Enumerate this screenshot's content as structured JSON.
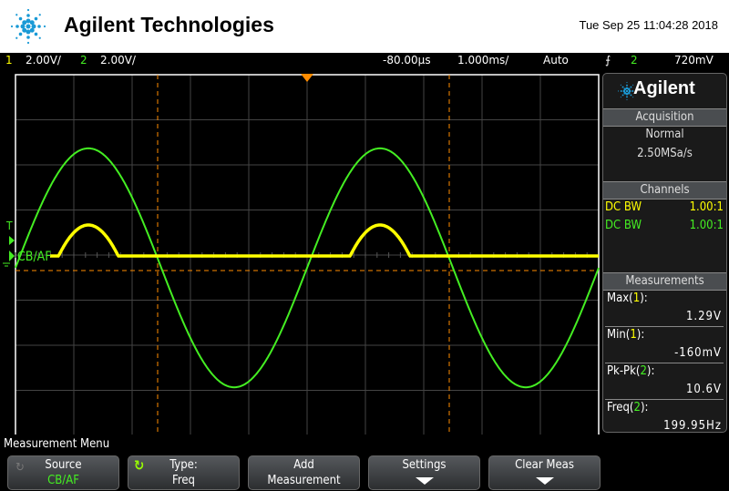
{
  "header": {
    "brand": "Agilent Technologies",
    "datetime": "Tue Sep 25 11:04:28 2018"
  },
  "status": {
    "ch1_num": "1",
    "ch1_scale": "2.00V/",
    "ch2_num": "2",
    "ch2_scale": "2.00V/",
    "time_offset": "-80.00µs",
    "time_scale": "1.000ms/",
    "trigger_mode": "Auto",
    "trigger_edge_icon": "rising-edge-icon",
    "trigger_source": "2",
    "trigger_level": "720mV"
  },
  "markers": {
    "trigger": "T",
    "ch2_label": "CB/AF"
  },
  "waveforms": {
    "ch2_frequency_hz": 199.95,
    "ch2_pk_pk_v": 10.6,
    "ch1_max_v": 1.29,
    "ch1_min_v": -0.16,
    "ch1_color": "#ffff00",
    "ch2_color": "#44ee22",
    "cursor_color": "#ff8c00"
  },
  "panel": {
    "title": "Agilent",
    "acquisition": {
      "title": "Acquisition",
      "mode": "Normal",
      "rate": "2.50MSa/s"
    },
    "channels": {
      "title": "Channels",
      "rows": [
        {
          "coupling": "DC BW",
          "probe": "1.00:1"
        },
        {
          "coupling": "DC BW",
          "probe": "1.00:1"
        }
      ]
    },
    "measurements": {
      "title": "Measurements",
      "items": [
        {
          "name": "Max(",
          "ch": "1",
          "close": "):",
          "value": "1.29V"
        },
        {
          "name": "Min(",
          "ch": "1",
          "close": "):",
          "value": "-160mV"
        },
        {
          "name": "Pk-Pk(",
          "ch": "2",
          "close": "):",
          "value": "10.6V"
        },
        {
          "name": "Freq(",
          "ch": "2",
          "close": "):",
          "value": "199.95Hz"
        }
      ]
    }
  },
  "menu": {
    "title": "Measurement Menu",
    "buttons": [
      {
        "top": "Source",
        "bottom": "CB/AF"
      },
      {
        "top": "Type:",
        "bottom": "Freq"
      },
      {
        "top": "Add",
        "bottom": "Measurement"
      },
      {
        "top": "Settings"
      },
      {
        "top": "Clear Meas"
      }
    ]
  }
}
